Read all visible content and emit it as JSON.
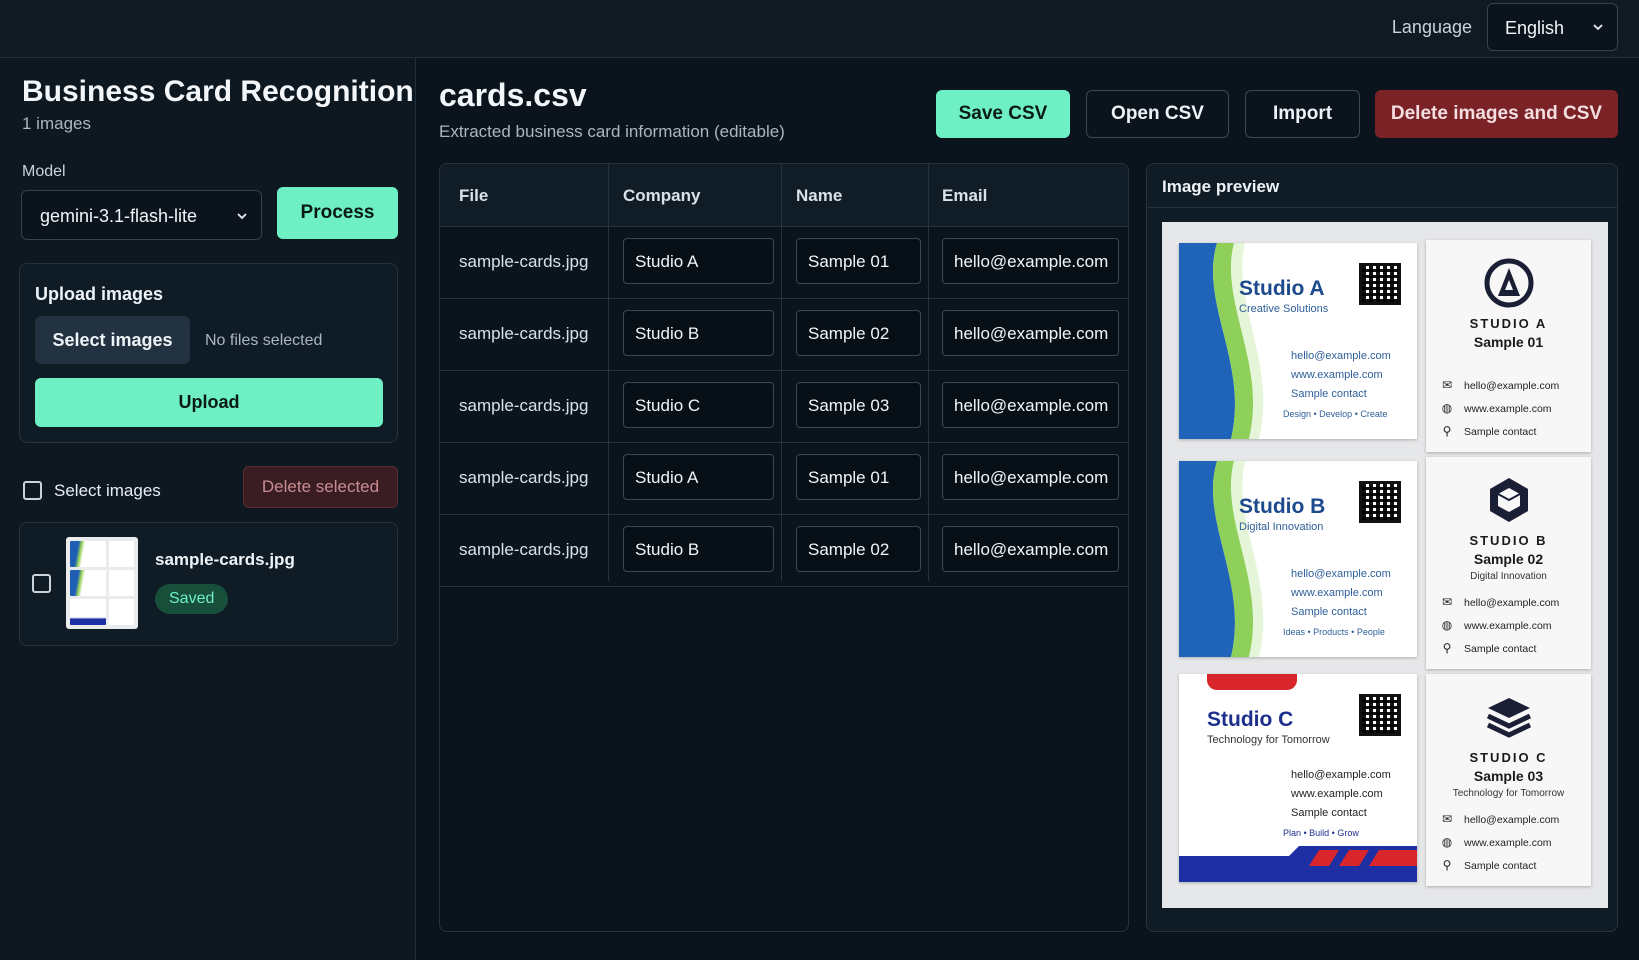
{
  "header": {
    "language_label": "Language",
    "language_value": "English"
  },
  "sidebar": {
    "title": "Business Card Recognition",
    "image_count": "1 images",
    "model_label": "Model",
    "model_value": "gemini-3.1-flash-lite",
    "process_label": "Process",
    "upload": {
      "title": "Upload images",
      "select_label": "Select images",
      "no_files": "No files selected",
      "upload_label": "Upload"
    },
    "select_all_label": "Select images",
    "delete_selected_label": "Delete selected",
    "files": [
      {
        "name": "sample-cards.jpg",
        "status": "Saved"
      }
    ]
  },
  "main": {
    "title": "cards.csv",
    "subtitle": "Extracted business card information (editable)",
    "save_label": "Save CSV",
    "open_label": "Open CSV",
    "import_label": "Import",
    "delete_label": "Delete images and CSV",
    "columns": [
      "File",
      "Company",
      "Name",
      "Email"
    ],
    "rows": [
      {
        "file": "sample-cards.jpg",
        "company": "Studio A",
        "name": "Sample 01",
        "email": "hello@example.com"
      },
      {
        "file": "sample-cards.jpg",
        "company": "Studio B",
        "name": "Sample 02",
        "email": "hello@example.com"
      },
      {
        "file": "sample-cards.jpg",
        "company": "Studio C",
        "name": "Sample 03",
        "email": "hello@example.com"
      },
      {
        "file": "sample-cards.jpg",
        "company": "Studio A",
        "name": "Sample 01",
        "email": "hello@example.com"
      },
      {
        "file": "sample-cards.jpg",
        "company": "Studio B",
        "name": "Sample 02",
        "email": "hello@example.com"
      }
    ]
  },
  "preview": {
    "title": "Image preview",
    "cards_horizontal": [
      {
        "name": "Studio A",
        "tagline": "Creative Solutions",
        "email": "hello@example.com",
        "web": "www.example.com",
        "contact": "Sample contact",
        "footer": "Design  •  Develop  •  Create"
      },
      {
        "name": "Studio B",
        "tagline": "Digital Innovation",
        "email": "hello@example.com",
        "web": "www.example.com",
        "contact": "Sample contact",
        "footer": "Ideas  •  Products  •  People"
      },
      {
        "name": "Studio C",
        "tagline": "Technology for Tomorrow",
        "email": "hello@example.com",
        "web": "www.example.com",
        "contact": "Sample contact",
        "footer": "Plan  •  Build  •  Grow"
      }
    ],
    "cards_vertical": [
      {
        "brand": "STUDIO A",
        "name": "Sample 01",
        "tagline": "",
        "email": "hello@example.com",
        "web": "www.example.com",
        "contact": "Sample contact"
      },
      {
        "brand": "STUDIO B",
        "name": "Sample 02",
        "tagline": "Digital Innovation",
        "email": "hello@example.com",
        "web": "www.example.com",
        "contact": "Sample contact"
      },
      {
        "brand": "STUDIO C",
        "name": "Sample 03",
        "tagline": "Technology for Tomorrow",
        "email": "hello@example.com",
        "web": "www.example.com",
        "contact": "Sample contact"
      }
    ]
  },
  "colors": {
    "accent": "#6ff0c4",
    "danger": "#7a2226",
    "background": "#0b141c"
  }
}
